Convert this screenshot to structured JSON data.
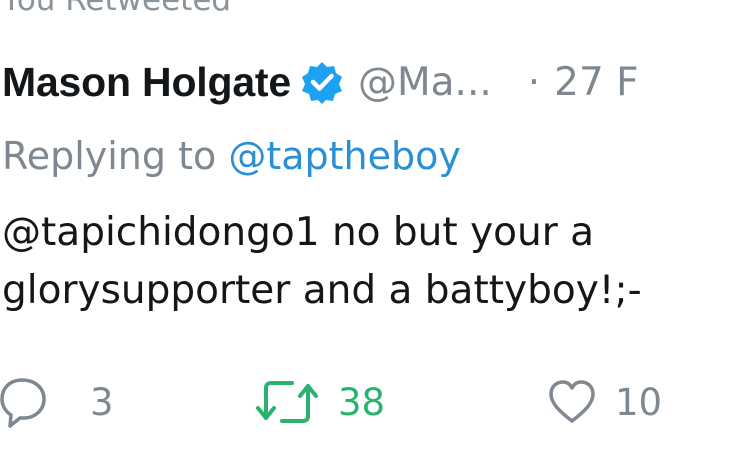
{
  "retweet_banner": "You Retweeted",
  "tweet": {
    "display_name": "Mason Holgate",
    "handle": "@Ma...",
    "separator": "·",
    "time": "27 F",
    "replying_prefix": "Replying to",
    "replying_to": "@taptheboy",
    "text_lines": [
      "@tapichidongo1 no but your a",
      "glorysupporter and a battyboy!;-"
    ]
  },
  "actions": {
    "replies": "3",
    "retweets": "38",
    "likes": "10"
  },
  "colors": {
    "verified": "#1da1f2",
    "link": "#2b8fd6",
    "retweeted": "#2ab36e",
    "muted": "#7f8891"
  },
  "icons": {
    "verified": "verified-badge-icon",
    "reply": "reply-icon",
    "retweet": "retweet-icon",
    "like": "heart-icon"
  }
}
